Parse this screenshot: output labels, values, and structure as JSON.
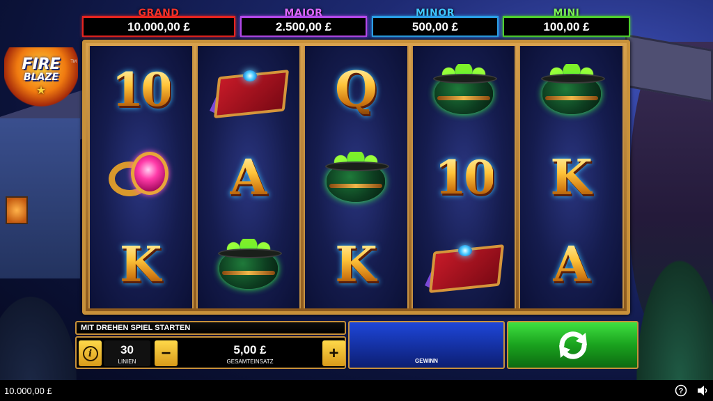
{
  "logo": {
    "line1": "FIRE",
    "line2": "BLAZE",
    "tm": "TM"
  },
  "jackpots": {
    "grand": {
      "label": "GRAND",
      "value": "10.000,00 £"
    },
    "major": {
      "label": "MAJOR",
      "value": "2.500,00 £"
    },
    "minor": {
      "label": "MINOR",
      "value": "500,00 £"
    },
    "mini": {
      "label": "MINI",
      "value": "100,00 £"
    }
  },
  "reels": [
    [
      "10",
      "ring",
      "K"
    ],
    [
      "book",
      "A",
      "cauldron"
    ],
    [
      "Q",
      "cauldron",
      "K"
    ],
    [
      "cauldron",
      "10",
      "book"
    ],
    [
      "cauldron",
      "K",
      "A"
    ]
  ],
  "controls": {
    "message": "MIT DREHEN SPIEL STARTEN",
    "lines_value": "30",
    "lines_label": "LINIEN",
    "stake_value": "5,00 £",
    "stake_label": "GESAMTEINSATZ",
    "minus": "−",
    "plus": "+",
    "win_label": "GEWINN",
    "info": "i"
  },
  "footer": {
    "balance": "10.000,00 £"
  },
  "colors": {
    "grand": "#e5241f",
    "major": "#b248e8",
    "minor": "#2a9ee5",
    "mini": "#4fcf2f",
    "frame_gold": "#c8913a",
    "spin_green": "#1aa21e",
    "win_blue": "#1532a6"
  },
  "icons": {
    "info": "info-icon",
    "spin": "refresh-arrows-icon",
    "help": "question-circle-icon",
    "sound": "speaker-icon"
  }
}
